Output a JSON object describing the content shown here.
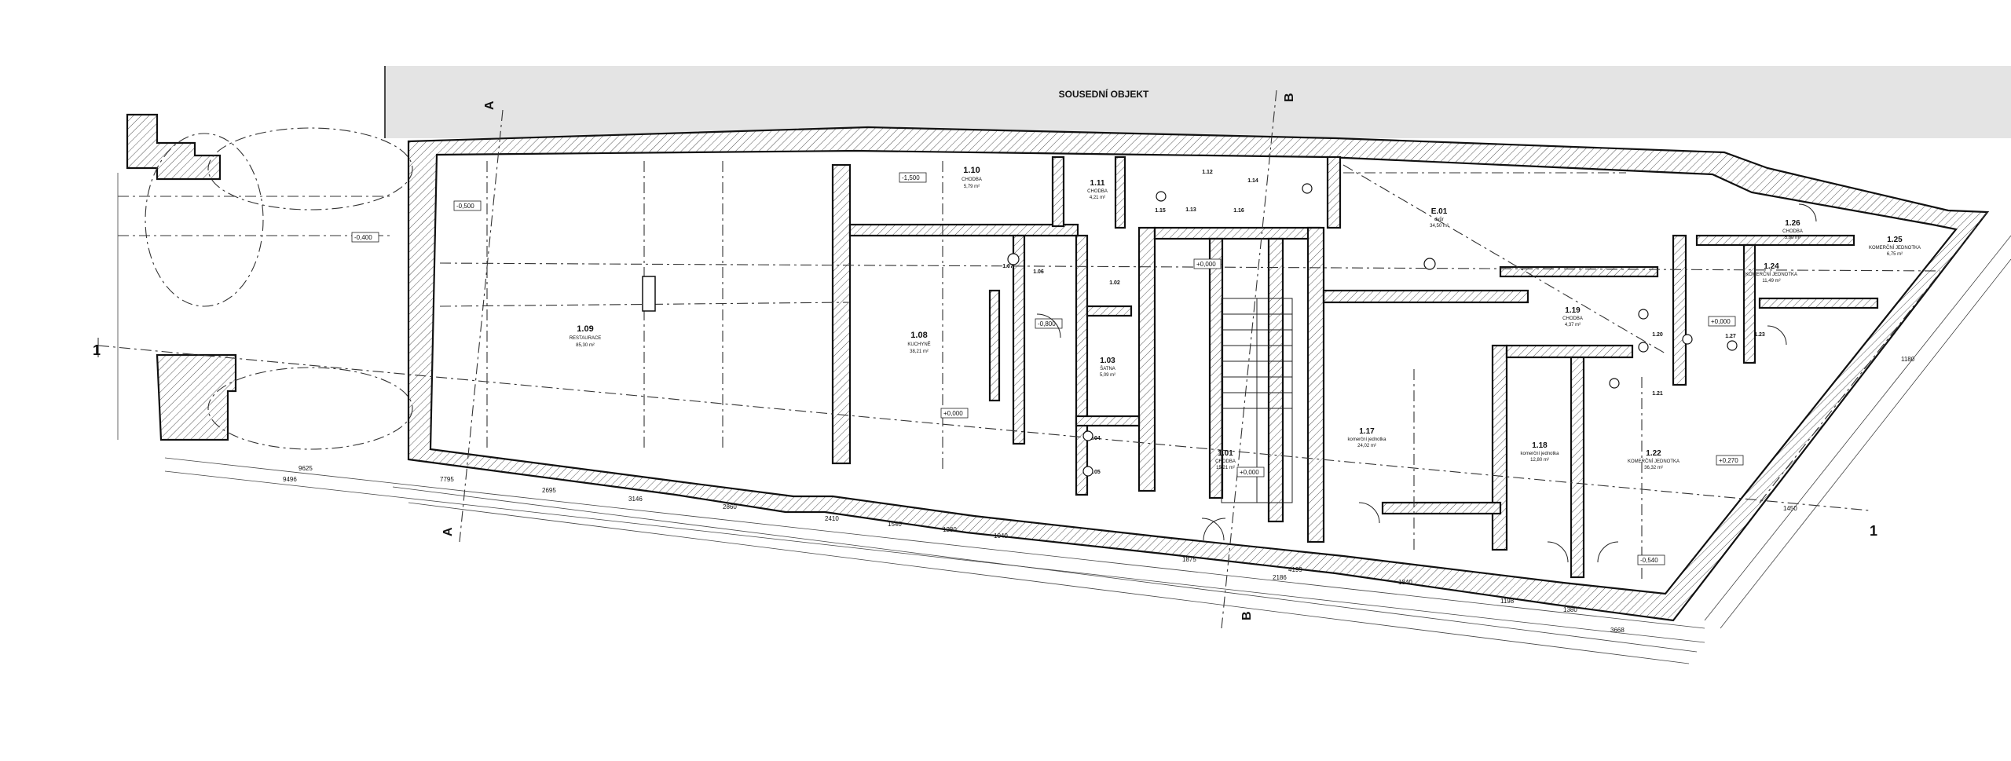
{
  "neighbor_label": "SOUSEDNÍ OBJEKT",
  "section_marks": {
    "a": "A",
    "b": "B",
    "one": "1"
  },
  "rooms": [
    {
      "id": "1.09",
      "name": "RESTAURACE",
      "area": "85,30 m²"
    },
    {
      "id": "1.08",
      "name": "KUCHYNĚ",
      "area": "38,21 m²"
    },
    {
      "id": "1.10",
      "name": "CHODBA",
      "area": "5,79 m²"
    },
    {
      "id": "1.11",
      "name": "CHODBA",
      "area": "4,21 m²"
    },
    {
      "id": "1.03",
      "name": "ŠATNA",
      "area": "5,09 m²"
    },
    {
      "id": "1.01",
      "name": "CHODBA",
      "area": "15,21 m²"
    },
    {
      "id": "1.17",
      "name": "komerční jednotka",
      "area": "24,02 m²"
    },
    {
      "id": "1.18",
      "name": "komerční jednotka",
      "area": "12,80 m²"
    },
    {
      "id": "1.22",
      "name": "KOMERČNÍ JEDNOTKA",
      "area": "36,32 m²"
    },
    {
      "id": "1.19",
      "name": "CHODBA",
      "area": "4,37 m²"
    },
    {
      "id": "1.24",
      "name": "KOMERČNÍ JEDNOTKA",
      "area": "11,49 m²"
    },
    {
      "id": "1.25",
      "name": "KOMERČNÍ JEDNOTKA",
      "area": "6,75 m²"
    },
    {
      "id": "1.26",
      "name": "CHODBA",
      "area": "5,80 m²"
    },
    {
      "id": "E.01",
      "name": "dvůr",
      "area": "34,50 m²"
    }
  ],
  "small_rooms": [
    "1.12",
    "1.13",
    "1.14",
    "1.15",
    "1.16",
    "1.07",
    "1.06",
    "1.02",
    "1.04",
    "1.05",
    "1.20",
    "1.21",
    "1.23",
    "1.27"
  ],
  "levels": {
    "l1": "+0,000",
    "l2": "-0,500",
    "l3": "-0,400",
    "l4": "-1,500",
    "l5": "-0,800",
    "l6": "+0,000",
    "l7": "+0,270",
    "l8": "+0,000",
    "l9": "+0,000",
    "l10": "-0,540"
  },
  "dims": {
    "d1": "9625",
    "d2": "9496",
    "d3": "7795",
    "d4": "2695",
    "d5": "3146",
    "d6": "2860",
    "d7": "2410",
    "d8": "1540",
    "d9": "1280",
    "d10": "1040",
    "d11": "1875",
    "d12": "4199",
    "d13": "1840",
    "d14": "2186",
    "d15": "3668",
    "d16": "1198",
    "d17": "1380",
    "d18": "1450",
    "d19": "1180"
  }
}
